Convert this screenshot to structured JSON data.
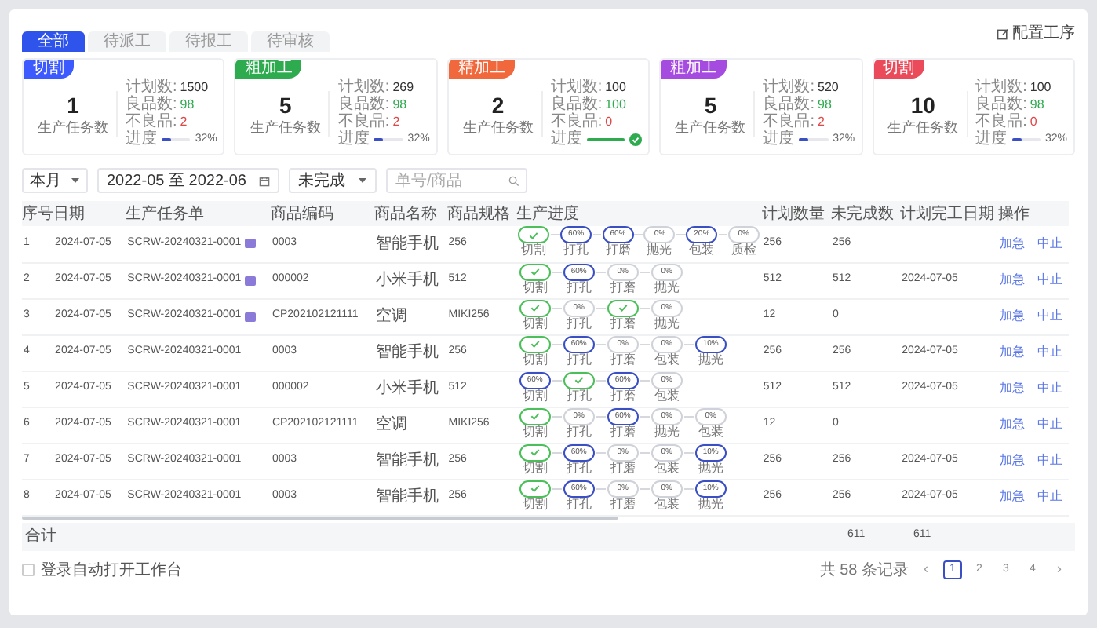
{
  "tabs": [
    {
      "label": "全部",
      "selected": true
    },
    {
      "label": "待派工",
      "selected": false
    },
    {
      "label": "待报工",
      "selected": false
    },
    {
      "label": "待审核",
      "selected": false
    }
  ],
  "config_button": "配置工序",
  "stat_cards": [
    {
      "tag": "切割",
      "color": "#3d5afe",
      "count": "1",
      "count_label": "生产任务数",
      "plan_label": "计划数:",
      "plan": "1500",
      "good_label": "良品数:",
      "good": "98",
      "bad_label": "不良品:",
      "bad": "2",
      "progress_label": "进度",
      "level": 0.32,
      "complete": false,
      "reading": "32%"
    },
    {
      "tag": "粗加工",
      "color": "#2eaa4f",
      "count": "5",
      "count_label": "生产任务数",
      "plan_label": "计划数:",
      "plan": "269",
      "good_label": "良品数:",
      "good": "98",
      "bad_label": "不良品:",
      "bad": "2",
      "progress_label": "进度",
      "level": 0.32,
      "complete": false,
      "reading": "32%"
    },
    {
      "tag": "精加工",
      "color": "#f0683c",
      "count": "2",
      "count_label": "生产任务数",
      "plan_label": "计划数:",
      "plan": "100",
      "good_label": "良品数:",
      "good": "100",
      "bad_label": "不良品:",
      "bad": "0",
      "progress_label": "进度",
      "level": 1,
      "complete": true
    },
    {
      "tag": "粗加工",
      "color": "#a64be0",
      "count": "5",
      "count_label": "生产任务数",
      "plan_label": "计划数:",
      "plan": "520",
      "good_label": "良品数:",
      "good": "98",
      "bad_label": "不良品:",
      "bad": "2",
      "progress_label": "进度",
      "level": 0.32,
      "complete": false,
      "reading": "32%"
    },
    {
      "tag": "切割",
      "color": "#ea4a5a",
      "count": "10",
      "count_label": "生产任务数",
      "plan_label": "计划数:",
      "plan": "100",
      "good_label": "良品数:",
      "good": "98",
      "bad_label": "不良品:",
      "bad": "0",
      "progress_label": "进度",
      "level": 0.32,
      "complete": false,
      "reading": "32%"
    }
  ],
  "filters": {
    "period": "本月",
    "date_range": "2022-05 至 2022-06",
    "status": "未完成",
    "search_placeholder": "单号/商品"
  },
  "table": {
    "columns": [
      "序号",
      "日期",
      "生产任务单",
      "商品编码",
      "商品名称",
      "商品规格",
      "生产进度",
      "计划数量",
      "未完成数",
      "计划完工日期",
      "操作"
    ],
    "rows": [
      {
        "no": "1",
        "date": "2024-07-05",
        "order": "SCRW-20240321-0001",
        "urgent": true,
        "code": "0003",
        "name": "智能手机",
        "spec": "256",
        "steps": [
          {
            "kind": "check",
            "label": "切割"
          },
          {
            "kind": "percent",
            "active": true,
            "pct": "60%",
            "label": "打孔"
          },
          {
            "kind": "percent",
            "active": true,
            "pct": "60%",
            "label": "打磨"
          },
          {
            "kind": "percent",
            "active": false,
            "pct": "0%",
            "label": "抛光"
          },
          {
            "kind": "percent",
            "active": true,
            "pct": "20%",
            "label": "包装"
          },
          {
            "kind": "percent",
            "active": false,
            "pct": "0%",
            "label": "质检"
          }
        ],
        "plan": "256",
        "open": "256",
        "due": "",
        "actions": [
          "加急",
          "中止"
        ]
      },
      {
        "no": "2",
        "date": "2024-07-05",
        "order": "SCRW-20240321-0001",
        "urgent": true,
        "code": "000002",
        "name": "小米手机",
        "spec": "512",
        "steps": [
          {
            "kind": "check",
            "label": "切割"
          },
          {
            "kind": "percent",
            "active": true,
            "pct": "60%",
            "label": "打孔"
          },
          {
            "kind": "percent",
            "active": false,
            "pct": "0%",
            "label": "打磨"
          },
          {
            "kind": "percent",
            "active": false,
            "pct": "0%",
            "label": "抛光"
          }
        ],
        "plan": "512",
        "open": "512",
        "due": "2024-07-05",
        "actions": [
          "加急",
          "中止"
        ]
      },
      {
        "no": "3",
        "date": "2024-07-05",
        "order": "SCRW-20240321-0001",
        "urgent": true,
        "code": "CP202102121111",
        "name": "空调",
        "spec": "MIKI256",
        "steps": [
          {
            "kind": "check",
            "label": "切割"
          },
          {
            "kind": "percent",
            "active": false,
            "pct": "0%",
            "label": "打孔"
          },
          {
            "kind": "check",
            "label": "打磨"
          },
          {
            "kind": "percent",
            "active": false,
            "pct": "0%",
            "label": "抛光"
          }
        ],
        "plan": "12",
        "open": "0",
        "due": "",
        "actions": [
          "加急",
          "中止"
        ]
      },
      {
        "no": "4",
        "date": "2024-07-05",
        "order": "SCRW-20240321-0001",
        "urgent": false,
        "code": "0003",
        "name": "智能手机",
        "spec": "256",
        "steps": [
          {
            "kind": "check",
            "label": "切割"
          },
          {
            "kind": "percent",
            "active": true,
            "pct": "60%",
            "label": "打孔"
          },
          {
            "kind": "percent",
            "active": false,
            "pct": "0%",
            "label": "打磨"
          },
          {
            "kind": "percent",
            "active": false,
            "pct": "0%",
            "label": "包装"
          },
          {
            "kind": "percent",
            "active": true,
            "pct": "10%",
            "label": "抛光"
          }
        ],
        "plan": "256",
        "open": "256",
        "due": "2024-07-05",
        "actions": [
          "加急",
          "中止"
        ]
      },
      {
        "no": "5",
        "date": "2024-07-05",
        "order": "SCRW-20240321-0001",
        "urgent": false,
        "code": "000002",
        "name": "小米手机",
        "spec": "512",
        "steps": [
          {
            "kind": "percent",
            "active": true,
            "pct": "60%",
            "label": "切割"
          },
          {
            "kind": "check",
            "label": "打孔"
          },
          {
            "kind": "percent",
            "active": true,
            "pct": "60%",
            "label": "打磨"
          },
          {
            "kind": "percent",
            "active": false,
            "pct": "0%",
            "label": "包装"
          }
        ],
        "plan": "512",
        "open": "512",
        "due": "2024-07-05",
        "actions": [
          "加急",
          "中止"
        ]
      },
      {
        "no": "6",
        "date": "2024-07-05",
        "order": "SCRW-20240321-0001",
        "urgent": false,
        "code": "CP202102121111",
        "name": "空调",
        "spec": "MIKI256",
        "steps": [
          {
            "kind": "check",
            "label": "切割"
          },
          {
            "kind": "percent",
            "active": false,
            "pct": "0%",
            "label": "打孔"
          },
          {
            "kind": "percent",
            "active": true,
            "pct": "60%",
            "label": "打磨"
          },
          {
            "kind": "percent",
            "active": false,
            "pct": "0%",
            "label": "抛光"
          },
          {
            "kind": "percent",
            "active": false,
            "pct": "0%",
            "label": "包装"
          }
        ],
        "plan": "12",
        "open": "0",
        "due": "",
        "actions": [
          "加急",
          "中止"
        ]
      },
      {
        "no": "7",
        "date": "2024-07-05",
        "order": "SCRW-20240321-0001",
        "urgent": false,
        "code": "0003",
        "name": "智能手机",
        "spec": "256",
        "steps": [
          {
            "kind": "check",
            "label": "切割"
          },
          {
            "kind": "percent",
            "active": true,
            "pct": "60%",
            "label": "打孔"
          },
          {
            "kind": "percent",
            "active": false,
            "pct": "0%",
            "label": "打磨"
          },
          {
            "kind": "percent",
            "active": false,
            "pct": "0%",
            "label": "包装"
          },
          {
            "kind": "percent",
            "active": true,
            "pct": "10%",
            "label": "抛光"
          }
        ],
        "plan": "256",
        "open": "256",
        "due": "2024-07-05",
        "actions": [
          "加急",
          "中止"
        ]
      },
      {
        "no": "8",
        "date": "2024-07-05",
        "order": "SCRW-20240321-0001",
        "urgent": false,
        "code": "0003",
        "name": "智能手机",
        "spec": "256",
        "steps": [
          {
            "kind": "check",
            "label": "切割"
          },
          {
            "kind": "percent",
            "active": true,
            "pct": "60%",
            "label": "打孔"
          },
          {
            "kind": "percent",
            "active": false,
            "pct": "0%",
            "label": "打磨"
          },
          {
            "kind": "percent",
            "active": false,
            "pct": "0%",
            "label": "包装"
          },
          {
            "kind": "percent",
            "active": true,
            "pct": "10%",
            "label": "抛光"
          }
        ],
        "plan": "256",
        "open": "256",
        "due": "2024-07-05",
        "actions": [
          "加急",
          "中止"
        ]
      }
    ],
    "total": {
      "label": "合计",
      "plan": "611",
      "open": "611"
    }
  },
  "auto_open": {
    "label": "登录自动打开工作台",
    "checked": false
  },
  "pagination": {
    "summary": "共 58 条记录",
    "prev": "‹",
    "next": "›",
    "pages": [
      {
        "label": "1",
        "selected": true
      },
      {
        "label": "2",
        "selected": false
      },
      {
        "label": "3",
        "selected": false
      },
      {
        "label": "4",
        "selected": false
      }
    ]
  }
}
